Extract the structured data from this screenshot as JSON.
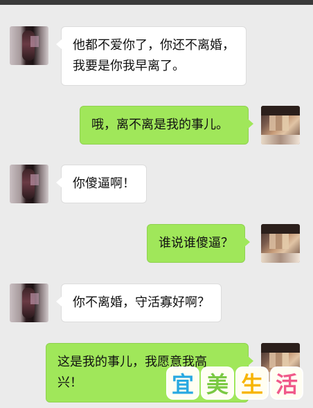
{
  "messages": [
    {
      "side": "in",
      "lines": [
        "他都不爱你了，你还不离婚，",
        "我要是你我早离了。"
      ]
    },
    {
      "side": "out",
      "lines": [
        "哦，离不离是我的事儿。"
      ]
    },
    {
      "side": "in",
      "lines": [
        "你傻逼啊！"
      ]
    },
    {
      "side": "out",
      "lines": [
        "谁说谁傻逼？"
      ]
    },
    {
      "side": "in",
      "lines": [
        "你不离婚，守活寡好啊？"
      ]
    },
    {
      "side": "out",
      "lines": [
        "这是我的事儿，我愿意我高",
        "兴！"
      ]
    }
  ],
  "watermark": {
    "chars": [
      "宜",
      "美",
      "生",
      "活"
    ],
    "colors": [
      "#29a9e1",
      "#7ac943",
      "#f7b500",
      "#f05a8a"
    ]
  },
  "colors": {
    "background": "#ebebeb",
    "outgoing_bubble": "#a0e75a",
    "incoming_bubble": "#ffffff"
  }
}
